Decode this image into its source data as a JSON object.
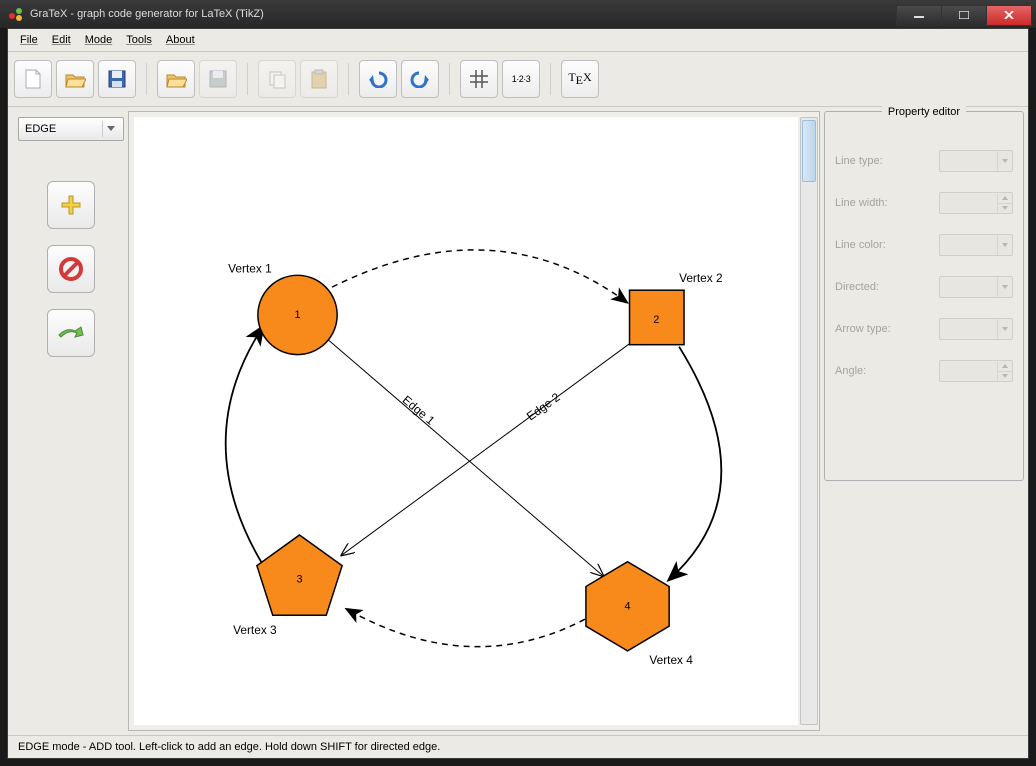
{
  "window": {
    "title": "GraTeX - graph code generator for LaTeX (TikZ)"
  },
  "menu": {
    "file": "File",
    "edit": "Edit",
    "mode": "Mode",
    "tools": "Tools",
    "about": "About"
  },
  "toolbar": {
    "numbering_label": "1·2·3",
    "tex_label": "TEX"
  },
  "sidebar": {
    "mode_value": "EDGE"
  },
  "vertices": {
    "v1": {
      "label": "Vertex 1",
      "num": "1"
    },
    "v2": {
      "label": "Vertex 2",
      "num": "2"
    },
    "v3": {
      "label": "Vertex 3",
      "num": "3"
    },
    "v4": {
      "label": "Vertex 4",
      "num": "4"
    }
  },
  "edges": {
    "e1": "Edge 1",
    "e2": "Edge 2"
  },
  "properties": {
    "panel_title": "Property editor",
    "line_type": "Line type:",
    "line_width": "Line width:",
    "line_color": "Line color:",
    "directed": "Directed:",
    "arrow_type": "Arrow type:",
    "angle": "Angle:"
  },
  "status": {
    "text": "EDGE mode - ADD tool. Left-click to add an edge. Hold down SHIFT for directed edge."
  },
  "colors": {
    "vertex_fill": "#f78a1b",
    "vertex_stroke": "#000"
  }
}
